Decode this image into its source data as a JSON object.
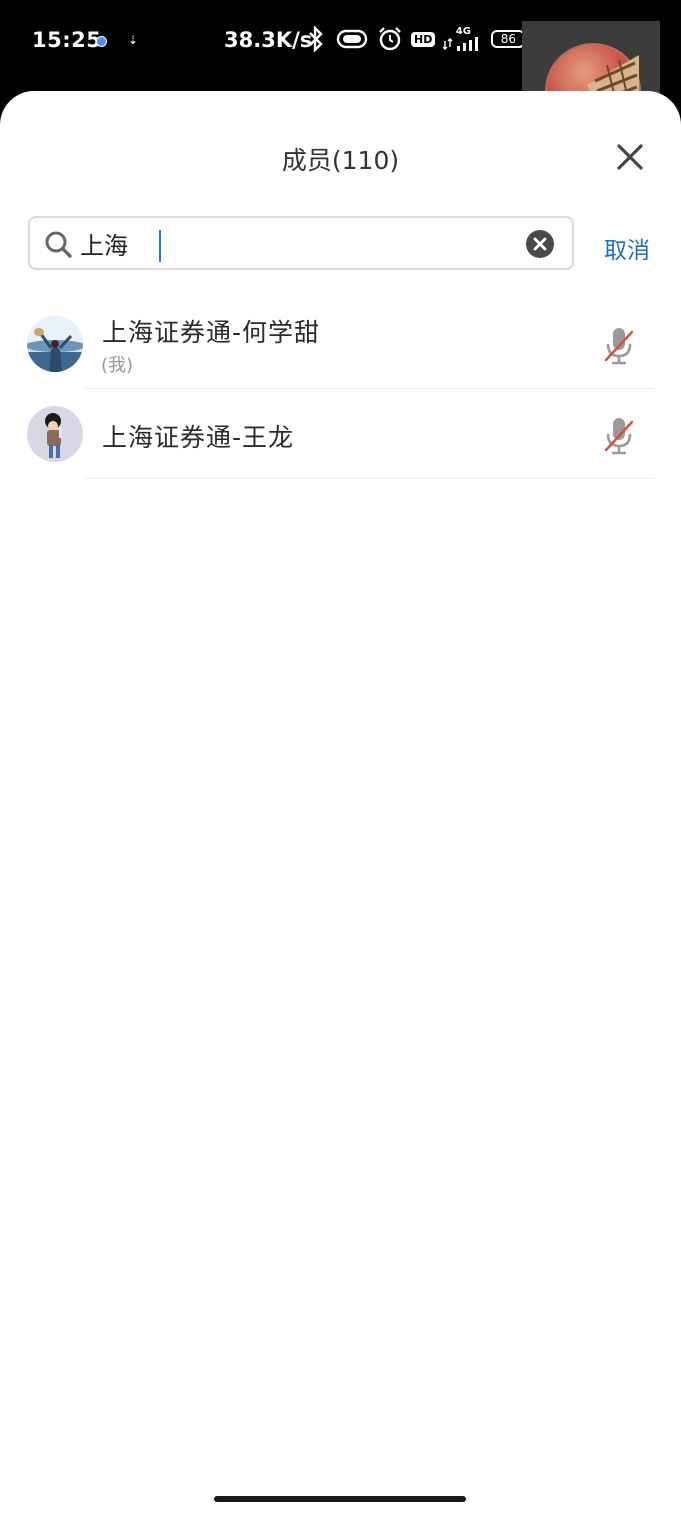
{
  "status_bar": {
    "time": "15:25",
    "net_speed": "38.3K/s",
    "network": "4G",
    "hd": "HD",
    "battery": "86",
    "icons": [
      "bluetooth-icon",
      "vibrate-icon",
      "alarm-icon",
      "hd-icon",
      "signal-icon",
      "battery-icon"
    ]
  },
  "sheet": {
    "title": "成员(110)"
  },
  "search": {
    "value": "上海",
    "cancel_label": "取消"
  },
  "members": [
    {
      "name": "上海证券通-何学甜",
      "sub": "(我)",
      "mic": "muted"
    },
    {
      "name": "上海证券通-王龙",
      "sub": "",
      "mic": "muted"
    }
  ],
  "colors": {
    "accent": "#1e6fc8",
    "mic_muted_slash": "#e04a3a",
    "mic_gray": "#9a9a9a"
  }
}
